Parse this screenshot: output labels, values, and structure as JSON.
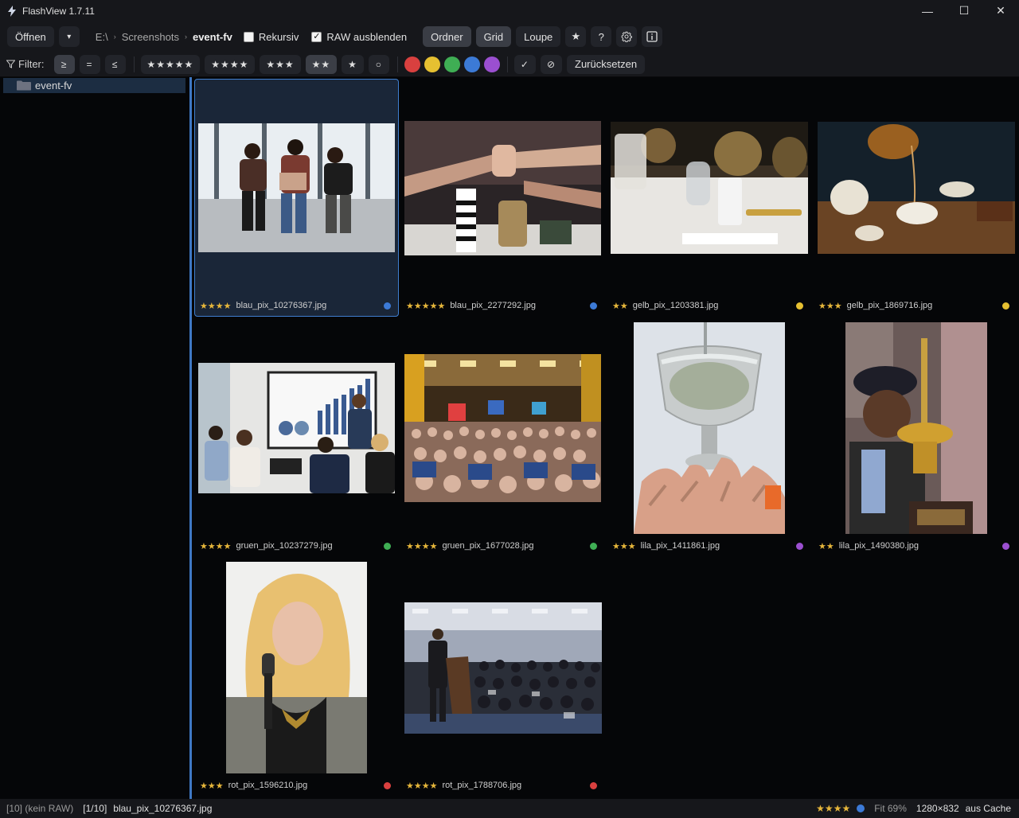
{
  "window": {
    "title": "FlashView 1.7.11",
    "minimize": "—",
    "maximize": "☐",
    "close": "✕"
  },
  "toolbar": {
    "open_label": "Öffnen",
    "open_dropdown": "▾",
    "breadcrumb": [
      "E:\\",
      "Screenshots",
      "event-fv"
    ],
    "breadcrumb_sep": "›",
    "recursive_label": "Rekursiv",
    "recursive_checked": false,
    "hide_raw_label": "RAW ausblenden",
    "hide_raw_checked": true,
    "view_folder": "Ordner",
    "view_grid": "Grid",
    "view_loupe": "Loupe",
    "star_button": "★",
    "help_button": "?",
    "settings_icon": "gear-icon",
    "info_icon": "info-icon"
  },
  "filter": {
    "label": "Filter:",
    "ops": [
      "≥",
      "=",
      "≤"
    ],
    "active_op": 0,
    "ratings": [
      "★★★★★",
      "★★★★",
      "★★★",
      "★★",
      "★",
      "○"
    ],
    "active_rating": 3,
    "colors": [
      "#d9403f",
      "#e6c031",
      "#3fae54",
      "#3c7ad6",
      "#9b4fd0"
    ],
    "accept": "✓",
    "reject": "⊘",
    "reset": "Zurücksetzen"
  },
  "sidebar": {
    "folder": "event-fv"
  },
  "grid": {
    "items": [
      {
        "stars": "★★★★",
        "name": "blau_pix_10276367.jpg",
        "color": "#3c7ad6"
      },
      {
        "stars": "★★★★★",
        "name": "blau_pix_2277292.jpg",
        "color": "#3c7ad6"
      },
      {
        "stars": "★★",
        "name": "gelb_pix_1203381.jpg",
        "color": "#e6c031"
      },
      {
        "stars": "★★★",
        "name": "gelb_pix_1869716.jpg",
        "color": "#e6c031"
      },
      {
        "stars": "★★★★",
        "name": "gruen_pix_10237279.jpg",
        "color": "#3fae54"
      },
      {
        "stars": "★★★★",
        "name": "gruen_pix_1677028.jpg",
        "color": "#3fae54"
      },
      {
        "stars": "★★★",
        "name": "lila_pix_1411861.jpg",
        "color": "#9b4fd0"
      },
      {
        "stars": "★★",
        "name": "lila_pix_1490380.jpg",
        "color": "#9b4fd0"
      },
      {
        "stars": "★★★",
        "name": "rot_pix_1596210.jpg",
        "color": "#d9403f"
      },
      {
        "stars": "★★★★",
        "name": "rot_pix_1788706.jpg",
        "color": "#d9403f"
      }
    ]
  },
  "status": {
    "count": "[10] (kein RAW)",
    "position": "[1/10]",
    "filename": "blau_pix_10276367.jpg",
    "rating": "★★★★",
    "color": "#3c7ad6",
    "zoom": "Fit 69%",
    "dimensions": "1280×832",
    "source": "aus Cache"
  }
}
